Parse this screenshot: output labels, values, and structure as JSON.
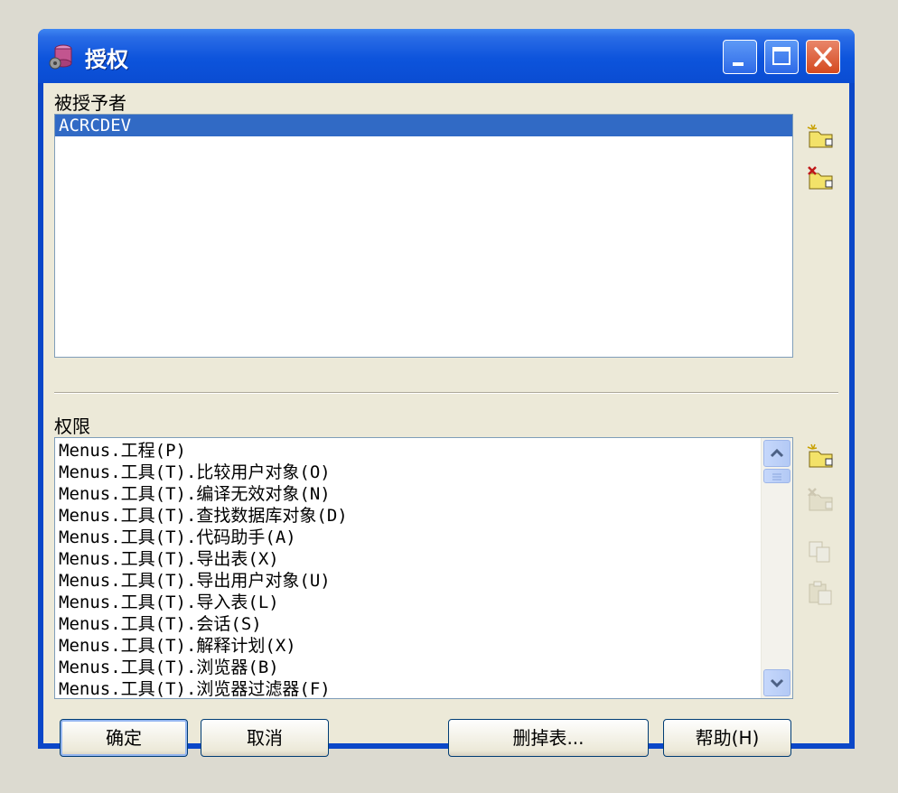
{
  "window": {
    "title": "授权"
  },
  "grantees": {
    "label": "被授予者",
    "items": [
      "ACRCDEV"
    ],
    "selected_index": 0
  },
  "privileges": {
    "label": "权限",
    "items": [
      "Menus.工程(P)",
      "Menus.工具(T).比较用户对象(O)",
      "Menus.工具(T).编译无效对象(N)",
      "Menus.工具(T).查找数据库对象(D)",
      "Menus.工具(T).代码助手(A)",
      "Menus.工具(T).导出表(X)",
      "Menus.工具(T).导出用户对象(U)",
      "Menus.工具(T).导入表(L)",
      "Menus.工具(T).会话(S)",
      "Menus.工具(T).解释计划(X)",
      "Menus.工具(T).浏览器(B)",
      "Menus.工具(T).浏览器过滤器(F)"
    ]
  },
  "buttons": {
    "ok": "确定",
    "cancel": "取消",
    "delete_table": "删掉表...",
    "help": "帮助(H)"
  },
  "icons": {
    "grantee_add": "new-item-icon",
    "grantee_remove": "delete-item-icon",
    "privilege_add": "new-item-icon",
    "privilege_remove": "delete-item-icon",
    "copy": "copy-icon",
    "paste": "paste-icon"
  }
}
